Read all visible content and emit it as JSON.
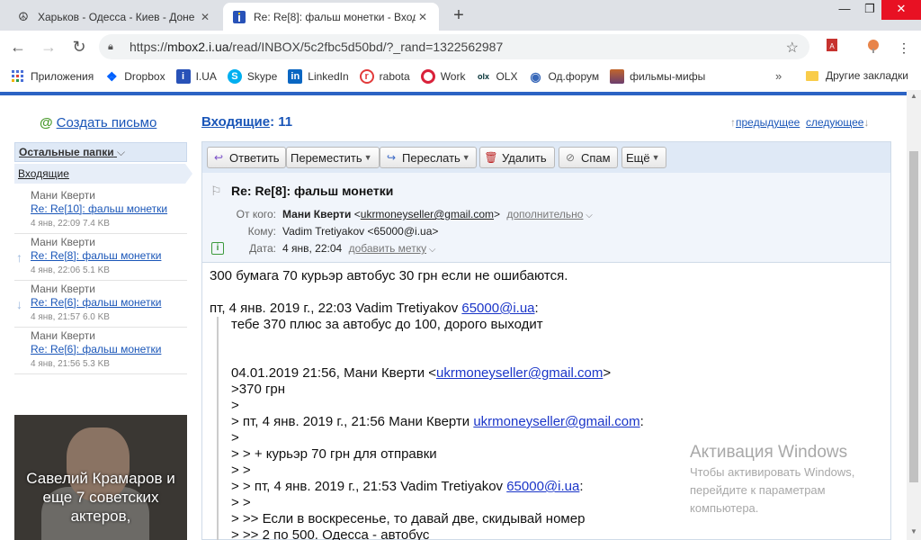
{
  "tabs": [
    {
      "title": "Харьков - Одесса - Киев - Доне",
      "icon": "peace-icon",
      "active": false
    },
    {
      "title": "Re: Re[8]: фальш монетки - Вход",
      "icon": "iua-icon",
      "active": true
    }
  ],
  "address_bar": {
    "url_prefix": "https://",
    "url_host": "mbox2.i.ua",
    "url_path": "/read/INBOX/5c2fbc5d50bd/?_rand=1322562987"
  },
  "bookmarks": {
    "items": [
      {
        "label": "Приложения",
        "icon": "apps-icon",
        "color": "#4a6fd8"
      },
      {
        "label": "Dropbox",
        "icon": "dropbox-icon",
        "color": "#0061fe"
      },
      {
        "label": "I.UA",
        "icon": "iua-icon",
        "color": "#2852b8"
      },
      {
        "label": "Skype",
        "icon": "skype-icon",
        "color": "#00aff0"
      },
      {
        "label": "LinkedIn",
        "icon": "linkedin-icon",
        "color": "#0a66c2"
      },
      {
        "label": "rabota",
        "icon": "rabota-icon",
        "color": "#e23b3b"
      },
      {
        "label": "Work",
        "icon": "work-icon",
        "color": "#d9213a"
      },
      {
        "label": "OLX",
        "icon": "olx-icon",
        "color": "#23e5db"
      },
      {
        "label": "Од.форум",
        "icon": "eye-icon",
        "color": "#3767b8"
      },
      {
        "label": "фильмы-мифы",
        "icon": "film-icon",
        "color": "#c2662c"
      }
    ],
    "more": "»",
    "other": "Другие закладки"
  },
  "sidebar": {
    "compose_at": "@",
    "compose": "Создать письмо",
    "other_folders": "Остальные папки",
    "inbox": "Входящие",
    "messages": [
      {
        "from": "Мани Кверти",
        "subject": "Re: Re[10]: фальш монетки",
        "meta": "4 янв, 22:09 7.4 KB",
        "icon": ""
      },
      {
        "from": "Мани Кверти",
        "subject": "Re: Re[8]: фальш монетки",
        "meta": "4 янв, 22:06 5.1 KB",
        "icon": "↑"
      },
      {
        "from": "Мани Кверти",
        "subject": "Re: Re[6]: фальш монетки",
        "meta": "4 янв, 21:57 6.0 KB",
        "icon": "↓"
      },
      {
        "from": "Мани Кверти",
        "subject": "Re: Re[6]: фальш монетки",
        "meta": "4 янв, 21:56 5.3 KB",
        "icon": ""
      }
    ],
    "promo_caption": "Савелий Крамаров и еще 7 советских актеров,"
  },
  "main": {
    "inbox_title": "Входящие",
    "inbox_count": ": 11",
    "prev": "предыдущее",
    "next": "следующее",
    "toolbar": {
      "reply": "Ответить",
      "move": "Переместить",
      "forward": "Переслать",
      "delete": "Удалить",
      "spam": "Спам",
      "more": "Ещё"
    },
    "header": {
      "subject": "Re: Re[8]: фальш монетки",
      "from_label": "От кого:",
      "from_name": "Мани Кверти",
      "from_email": "ukrmoneyseller@gmail.com",
      "from_more": "дополнительно",
      "to_label": "Кому:",
      "to_value": "Vadim Tretiyakov <65000@i.ua>",
      "date_label": "Дата:",
      "date_value": "4 янв, 22:04",
      "date_more": "добавить метку"
    },
    "body": {
      "line1": "300 бумага 70 курьэр автобус 30 грн если не ошибаются.",
      "q_intro_pre": "пт, 4 янв. 2019 г., 22:03 Vadim Tretiyakov ",
      "q_intro_link": "65000@i.ua",
      "q_intro_post": ":",
      "q1": "тебе 370 плюс за автобус до 100, дорого выходит",
      "q2_pre": "04.01.2019 21:56, Мани Кверти <",
      "q2_link": "ukrmoneyseller@gmail.com",
      "q2_post": ">",
      "q3": ">370 грн",
      "q4": ">",
      "q5_pre": "> пт, 4 янв. 2019 г., 21:56 Мани Кверти ",
      "q5_link": "ukrmoneyseller@gmail.com",
      "q5_post": ":",
      "q6": ">",
      "q7": "> > + курьэр 70 грн для отправки",
      "q8": "> >",
      "q9_pre": "> > пт, 4 янв. 2019 г., 21:53 Vadim Tretiyakov ",
      "q9_link": "65000@i.ua",
      "q9_post": ":",
      "q10": "> >",
      "q11": "> >> Если в воскресенье, то давай две, скидывай номер",
      "q12": "> >> 2 по 500. Одесса - автобус"
    }
  },
  "watermark": {
    "title": "Активация Windows",
    "line1": "Чтобы активировать Windows,",
    "line2": "перейдите к параметрам",
    "line3": "компьютера."
  }
}
